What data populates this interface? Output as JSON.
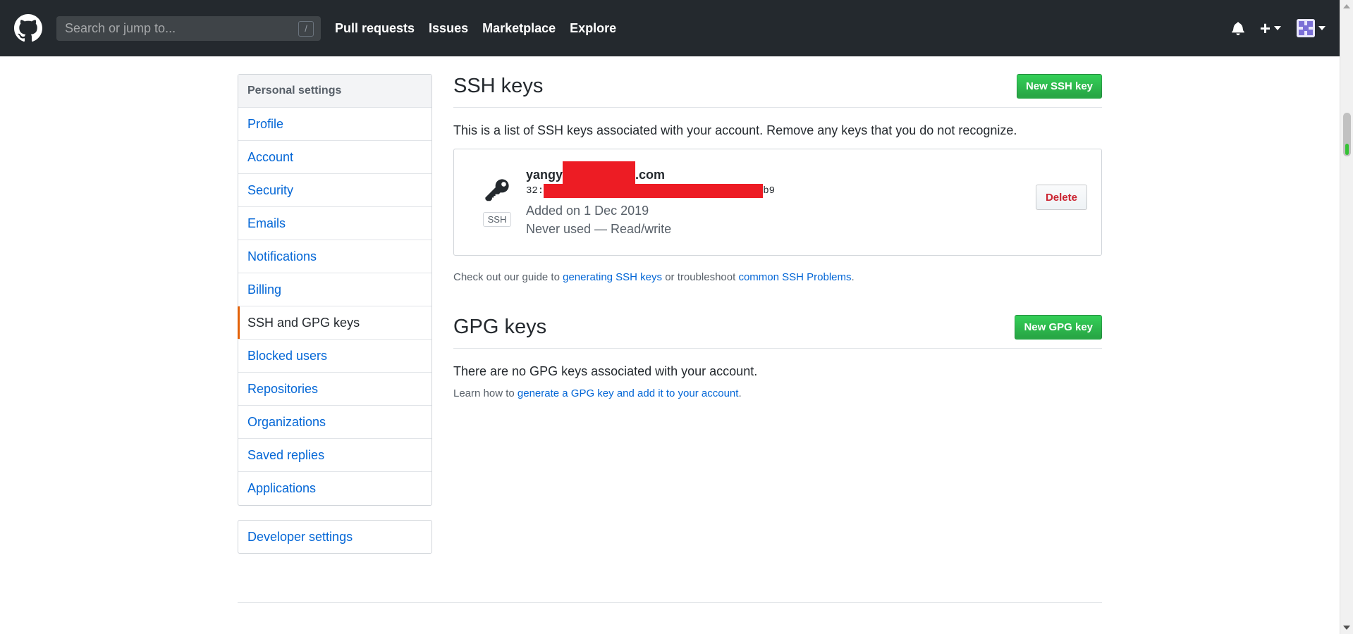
{
  "header": {
    "search_placeholder": "Search or jump to...",
    "search_shortcut": "/",
    "nav": [
      "Pull requests",
      "Issues",
      "Marketplace",
      "Explore"
    ]
  },
  "sidebar": {
    "heading": "Personal settings",
    "items": [
      {
        "label": "Profile"
      },
      {
        "label": "Account"
      },
      {
        "label": "Security"
      },
      {
        "label": "Emails"
      },
      {
        "label": "Notifications"
      },
      {
        "label": "Billing"
      },
      {
        "label": "SSH and GPG keys",
        "selected": true
      },
      {
        "label": "Blocked users"
      },
      {
        "label": "Repositories"
      },
      {
        "label": "Organizations"
      },
      {
        "label": "Saved replies"
      },
      {
        "label": "Applications"
      }
    ],
    "developer_settings": "Developer settings"
  },
  "ssh": {
    "title": "SSH keys",
    "new_button": "New SSH key",
    "description": "This is a list of SSH keys associated with your account. Remove any keys that you do not recognize.",
    "key": {
      "title_prefix": "yangy",
      "title_suffix": ".com",
      "fingerprint_prefix": "32:",
      "fingerprint_suffix": "b9",
      "badge": "SSH",
      "added": "Added on 1 Dec 2019",
      "usage": "Never used — Read/write",
      "delete_label": "Delete"
    },
    "note_pre": "Check out our guide to ",
    "note_link1": "generating SSH keys",
    "note_mid": " or troubleshoot ",
    "note_link2": "common SSH Problems",
    "note_post": "."
  },
  "gpg": {
    "title": "GPG keys",
    "new_button": "New GPG key",
    "description": "There are no GPG keys associated with your account.",
    "note_pre": "Learn how to ",
    "note_link": "generate a GPG key and add it to your account",
    "note_post": "."
  },
  "colors": {
    "header_bg": "#24292e",
    "link": "#0366d6",
    "green": "#28a745",
    "danger": "#cb2431",
    "selected_marker": "#e36209",
    "redaction": "#ed1c24"
  }
}
